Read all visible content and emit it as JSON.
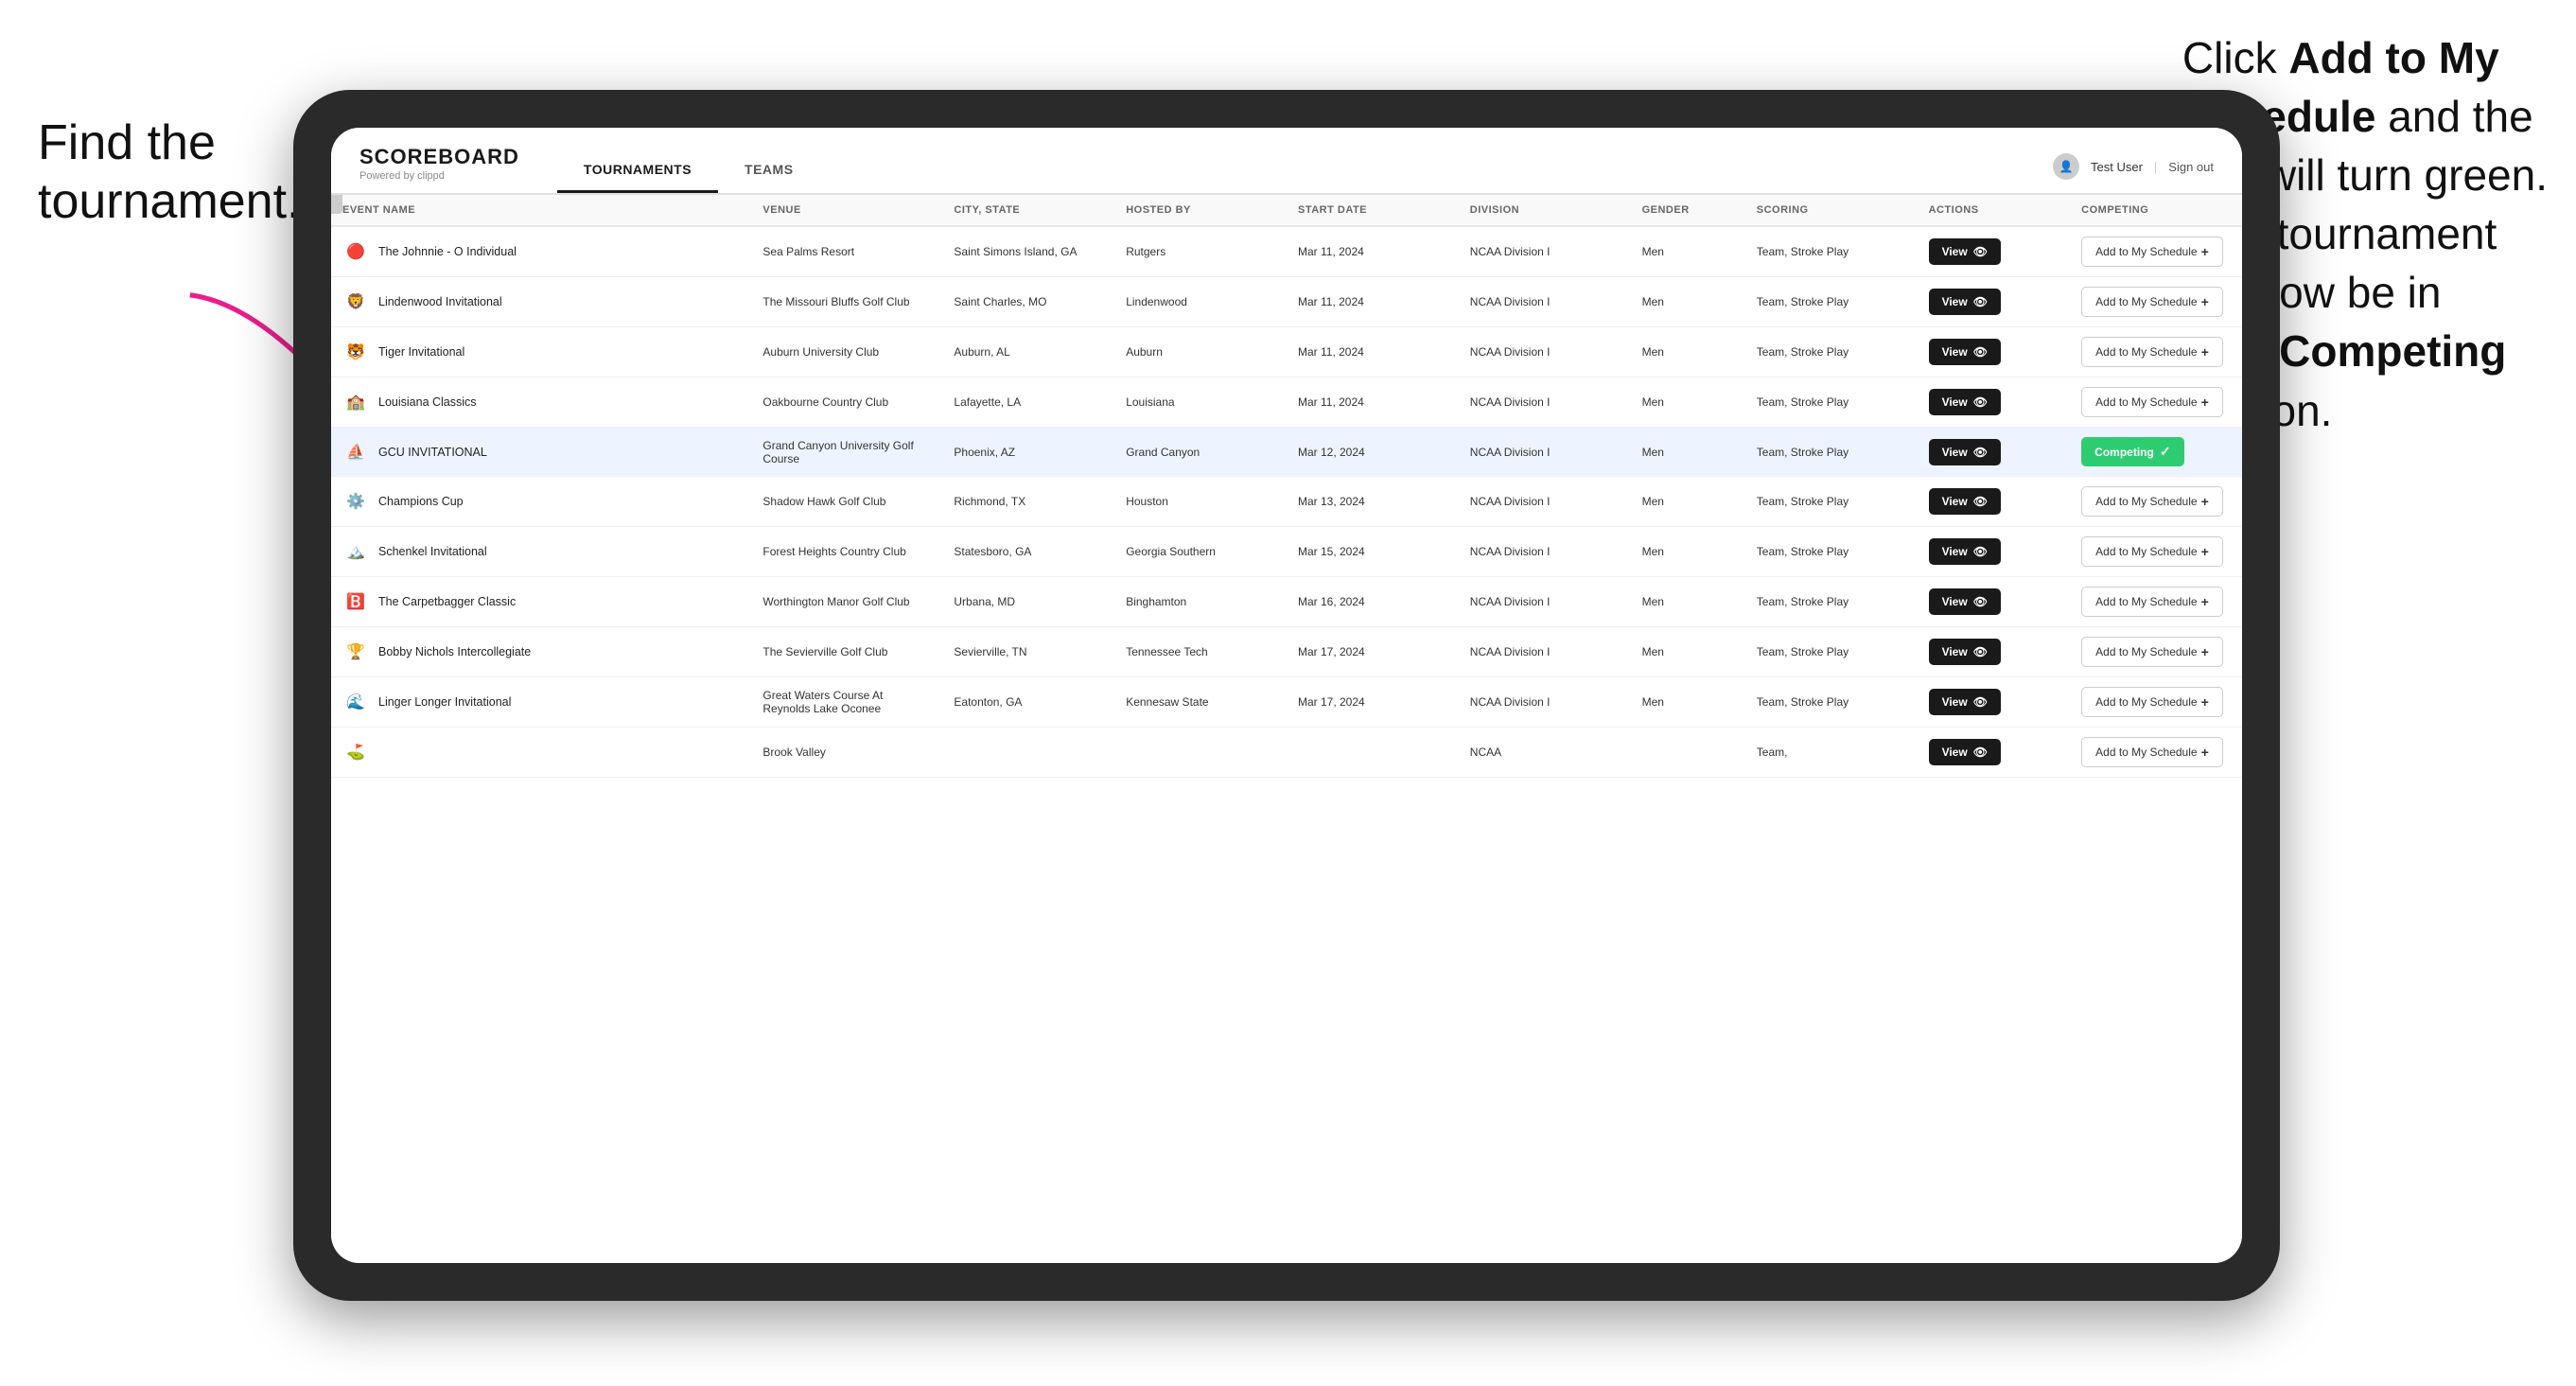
{
  "annotations": {
    "left": "Find the\ntournament.",
    "right_line1": "Click ",
    "right_bold1": "Add to My\nSchedule",
    "right_line2": " and the\nbox will turn green.\nThis tournament\nwill now be in\nyour ",
    "right_bold2": "Competing",
    "right_line3": "\nsection."
  },
  "header": {
    "logo_title": "SCOREBOARD",
    "logo_subtitle": "Powered by clippd",
    "nav_tabs": [
      {
        "label": "TOURNAMENTS",
        "active": true
      },
      {
        "label": "TEAMS",
        "active": false
      }
    ],
    "user_name": "Test User",
    "sign_out": "Sign out"
  },
  "table": {
    "columns": [
      {
        "key": "event_name",
        "label": "EVENT NAME"
      },
      {
        "key": "venue",
        "label": "VENUE"
      },
      {
        "key": "city_state",
        "label": "CITY, STATE"
      },
      {
        "key": "hosted_by",
        "label": "HOSTED BY"
      },
      {
        "key": "start_date",
        "label": "START DATE"
      },
      {
        "key": "division",
        "label": "DIVISION"
      },
      {
        "key": "gender",
        "label": "GENDER"
      },
      {
        "key": "scoring",
        "label": "SCORING"
      },
      {
        "key": "actions",
        "label": "ACTIONS"
      },
      {
        "key": "competing",
        "label": "COMPETING"
      }
    ],
    "rows": [
      {
        "id": 1,
        "logo": "🔴",
        "event_name": "The Johnnie - O Individual",
        "venue": "Sea Palms Resort",
        "city_state": "Saint Simons Island, GA",
        "hosted_by": "Rutgers",
        "start_date": "Mar 11, 2024",
        "division": "NCAA Division I",
        "gender": "Men",
        "scoring": "Team, Stroke Play",
        "status": "add",
        "highlighted": false
      },
      {
        "id": 2,
        "logo": "🦁",
        "event_name": "Lindenwood Invitational",
        "venue": "The Missouri Bluffs Golf Club",
        "city_state": "Saint Charles, MO",
        "hosted_by": "Lindenwood",
        "start_date": "Mar 11, 2024",
        "division": "NCAA Division I",
        "gender": "Men",
        "scoring": "Team, Stroke Play",
        "status": "add",
        "highlighted": false
      },
      {
        "id": 3,
        "logo": "🐯",
        "event_name": "Tiger Invitational",
        "venue": "Auburn University Club",
        "city_state": "Auburn, AL",
        "hosted_by": "Auburn",
        "start_date": "Mar 11, 2024",
        "division": "NCAA Division I",
        "gender": "Men",
        "scoring": "Team, Stroke Play",
        "status": "add",
        "highlighted": false
      },
      {
        "id": 4,
        "logo": "🏫",
        "event_name": "Louisiana Classics",
        "venue": "Oakbourne Country Club",
        "city_state": "Lafayette, LA",
        "hosted_by": "Louisiana",
        "start_date": "Mar 11, 2024",
        "division": "NCAA Division I",
        "gender": "Men",
        "scoring": "Team, Stroke Play",
        "status": "add",
        "highlighted": false
      },
      {
        "id": 5,
        "logo": "⛵",
        "event_name": "GCU INVITATIONAL",
        "venue": "Grand Canyon University Golf Course",
        "city_state": "Phoenix, AZ",
        "hosted_by": "Grand Canyon",
        "start_date": "Mar 12, 2024",
        "division": "NCAA Division I",
        "gender": "Men",
        "scoring": "Team, Stroke Play",
        "status": "competing",
        "highlighted": true
      },
      {
        "id": 6,
        "logo": "⚙️",
        "event_name": "Champions Cup",
        "venue": "Shadow Hawk Golf Club",
        "city_state": "Richmond, TX",
        "hosted_by": "Houston",
        "start_date": "Mar 13, 2024",
        "division": "NCAA Division I",
        "gender": "Men",
        "scoring": "Team, Stroke Play",
        "status": "add",
        "highlighted": false
      },
      {
        "id": 7,
        "logo": "🏔️",
        "event_name": "Schenkel Invitational",
        "venue": "Forest Heights Country Club",
        "city_state": "Statesboro, GA",
        "hosted_by": "Georgia Southern",
        "start_date": "Mar 15, 2024",
        "division": "NCAA Division I",
        "gender": "Men",
        "scoring": "Team, Stroke Play",
        "status": "add",
        "highlighted": false
      },
      {
        "id": 8,
        "logo": "🅱️",
        "event_name": "The Carpetbagger Classic",
        "venue": "Worthington Manor Golf Club",
        "city_state": "Urbana, MD",
        "hosted_by": "Binghamton",
        "start_date": "Mar 16, 2024",
        "division": "NCAA Division I",
        "gender": "Men",
        "scoring": "Team, Stroke Play",
        "status": "add",
        "highlighted": false
      },
      {
        "id": 9,
        "logo": "🏆",
        "event_name": "Bobby Nichols Intercollegiate",
        "venue": "The Sevierville Golf Club",
        "city_state": "Sevierville, TN",
        "hosted_by": "Tennessee Tech",
        "start_date": "Mar 17, 2024",
        "division": "NCAA Division I",
        "gender": "Men",
        "scoring": "Team, Stroke Play",
        "status": "add",
        "highlighted": false
      },
      {
        "id": 10,
        "logo": "🌊",
        "event_name": "Linger Longer Invitational",
        "venue": "Great Waters Course At Reynolds Lake Oconee",
        "city_state": "Eatonton, GA",
        "hosted_by": "Kennesaw State",
        "start_date": "Mar 17, 2024",
        "division": "NCAA Division I",
        "gender": "Men",
        "scoring": "Team, Stroke Play",
        "status": "add",
        "highlighted": false
      },
      {
        "id": 11,
        "logo": "⛳",
        "event_name": "",
        "venue": "Brook Valley",
        "city_state": "",
        "hosted_by": "",
        "start_date": "",
        "division": "NCAA",
        "gender": "",
        "scoring": "Team,",
        "status": "add",
        "highlighted": false
      }
    ],
    "view_label": "View",
    "add_schedule_label": "Add to My Schedule",
    "competing_label": "Competing"
  },
  "colors": {
    "competing_green": "#2ecc71",
    "header_dark": "#1a1a1a",
    "highlighted_row": "#eef4ff"
  }
}
